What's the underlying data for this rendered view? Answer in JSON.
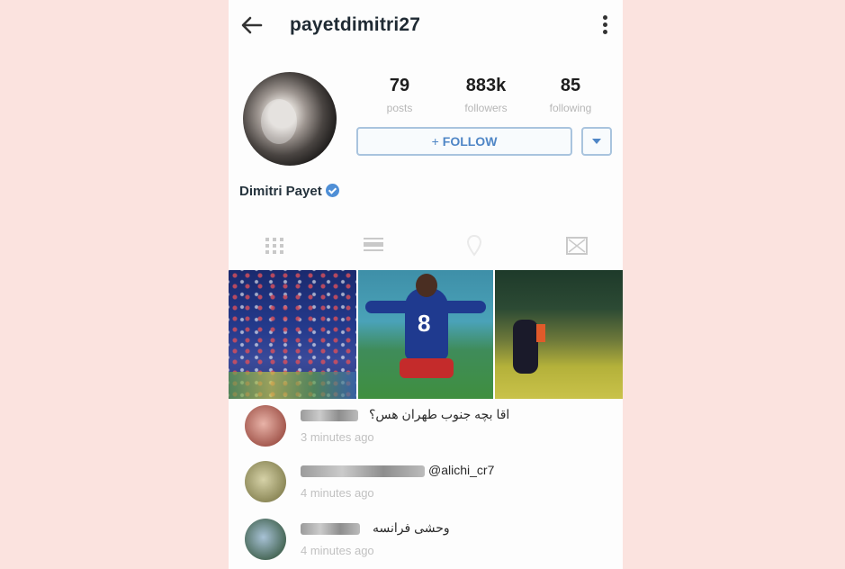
{
  "header": {
    "username": "payetdimitri27"
  },
  "profile": {
    "stats": [
      {
        "value": "79",
        "label": "posts"
      },
      {
        "value": "883k",
        "label": "followers"
      },
      {
        "value": "85",
        "label": "following"
      }
    ],
    "follow_label": "FOLLOW",
    "follow_plus": "+",
    "full_name": "Dimitri Payet",
    "verified": true
  },
  "tabs": [
    {
      "icon": "grid-icon"
    },
    {
      "icon": "list-icon"
    },
    {
      "icon": "map-pin-icon"
    },
    {
      "icon": "tagged-icon"
    }
  ],
  "comments": [
    {
      "text": "اقا بچه جنوب طهران هس؟",
      "time": "3 minutes ago"
    },
    {
      "text": "@alichi_cr7",
      "time": "4 minutes ago"
    },
    {
      "text": "وحشی فرانسه",
      "time": "4 minutes ago"
    }
  ],
  "colors": {
    "background": "#fbe3df",
    "follow_blue": "#4f86c6",
    "verified_blue": "#4f8fd6"
  }
}
